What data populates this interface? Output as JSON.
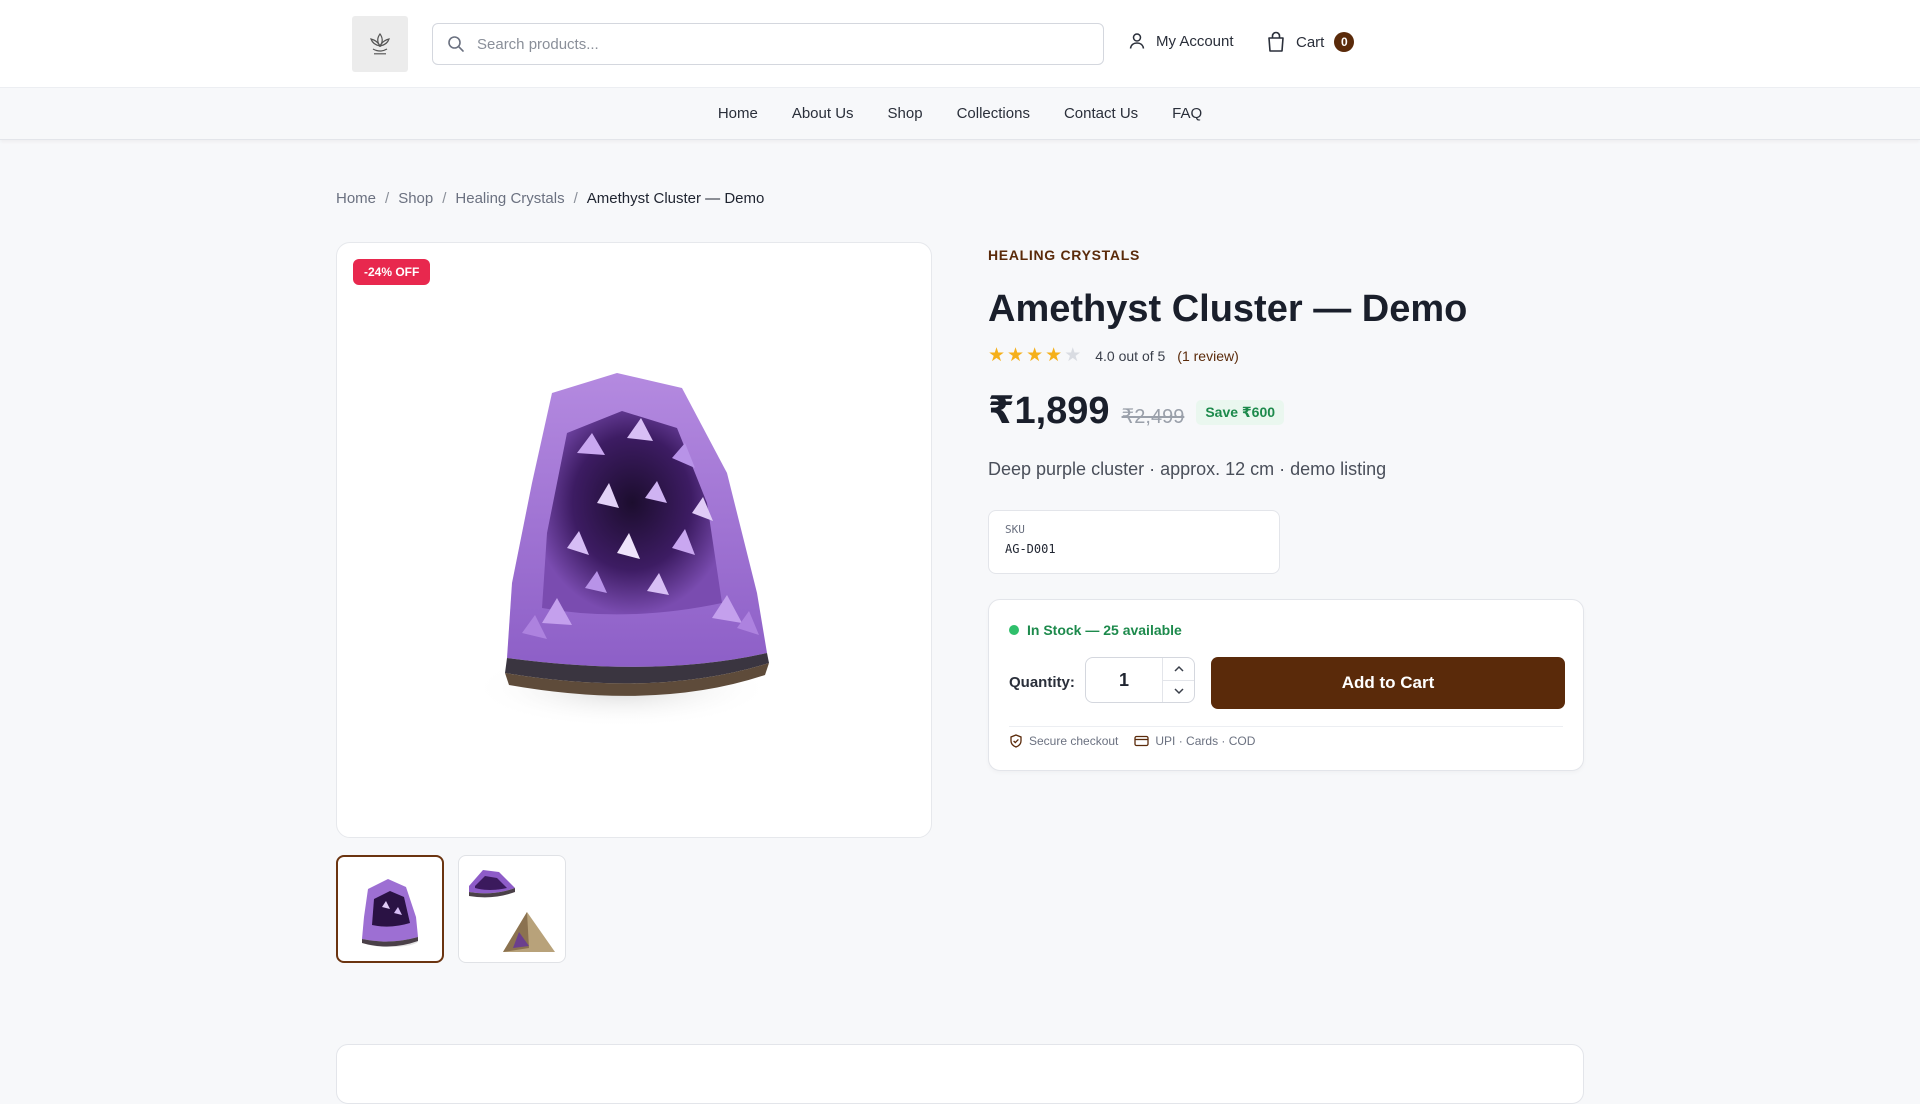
{
  "header": {
    "search_placeholder": "Search products...",
    "account_label": "My Account",
    "cart_label": "Cart",
    "cart_count": "0"
  },
  "nav": {
    "items": [
      "Home",
      "About Us",
      "Shop",
      "Collections",
      "Contact Us",
      "FAQ"
    ]
  },
  "breadcrumb": {
    "items": [
      "Home",
      "Shop",
      "Healing Crystals"
    ],
    "separator": "/",
    "current": "Amethyst Cluster — Demo"
  },
  "gallery": {
    "badge": "-24% OFF",
    "thumbnails": [
      "amethyst-cluster",
      "amethyst-and-pyramid"
    ]
  },
  "product": {
    "category": "HEALING CRYSTALS",
    "title": "Amethyst Cluster — Demo",
    "rating_value": 4,
    "rating_max": 5,
    "rating_text": "4.0 out of 5",
    "reviews_text": "(1 review)",
    "price": "₹1,899",
    "original_price": "₹2,499",
    "save_text": "Save ₹600",
    "description": "Deep purple cluster · approx. 12 cm · demo listing",
    "sku_label": "SKU",
    "sku_value": "AG-D001"
  },
  "purchase": {
    "stock_text": "In Stock — 25 available",
    "quantity_label": "Quantity:",
    "quantity_value": "1",
    "add_to_cart_label": "Add to Cart",
    "trust_secure": "Secure checkout",
    "trust_payment": "UPI · Cards · COD"
  },
  "colors": {
    "brand": "#5a2a0a",
    "discount_badge": "#e8284e",
    "star_filled": "#f5b01b",
    "star_empty": "#d9dce2",
    "in_stock": "#1d8a4c"
  }
}
